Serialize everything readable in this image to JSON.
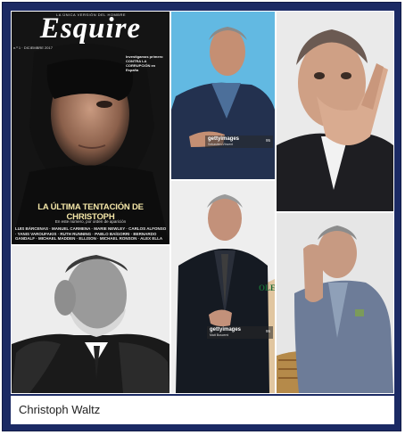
{
  "caption": "Christoph Waltz",
  "cover": {
    "tagline": "LA ÚNICA VERSIÓN DEL HOMBRE",
    "title": "Esquire",
    "date": "n.º 1 · DICIEMBRE 2017",
    "side_text": "Investigamos primero CONTRA LA CORRUPCIÓN en España",
    "headline": "LA ÚLTIMA TENTACIÓN DE CHRISTOPH",
    "subheadline": "En este número, por orden de aparición",
    "names": "LUIS BÁRCENAS · MANUEL CARMENA · MARIE NEWLEY · CARLOS ALFONSO · YANIS VAROUFAKIS · RUTH RUNNING · PABLO BAÍGORRI · BERNARDO GANDALF · MICHAEL MADDEN · ELLISON · MICHAEL RONSON · ALEX ELLA"
  },
  "watermarks": [
    {
      "brand": "gettyimages",
      "credit": "Sebastien Vincent",
      "id": "95"
    },
    {
      "brand": "gettyimages",
      "credit": "Matt Buscemi",
      "id": "95"
    }
  ],
  "rolex_text": "OLE",
  "colors": {
    "frame": "#1b2a64",
    "photo_bg": "#ffffff",
    "headline_accent": "#f5e7a8"
  }
}
